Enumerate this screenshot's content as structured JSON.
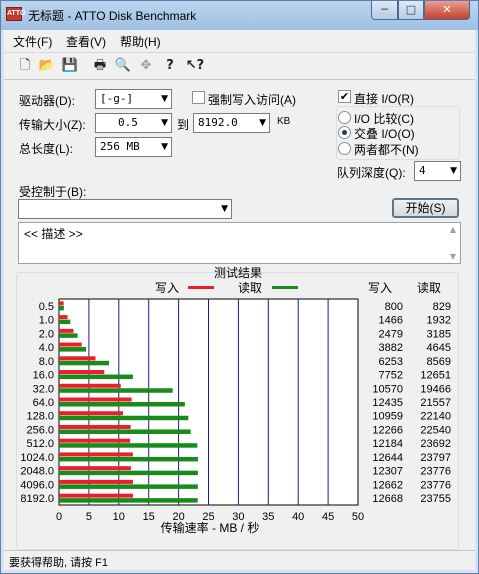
{
  "window": {
    "title": "无标题 - ATTO Disk Benchmark",
    "app_icon": "ATTO",
    "min_label": "─",
    "max_label": "□",
    "close_label": "✕"
  },
  "menu": [
    "文件(F)",
    "查看(V)",
    "帮助(H)"
  ],
  "toolbar": [
    {
      "icon": "new-file-icon",
      "glyph": "🗋"
    },
    {
      "icon": "open-folder-icon",
      "glyph": "📂"
    },
    {
      "icon": "save-icon",
      "glyph": "💾"
    },
    {
      "icon": "print-icon",
      "glyph": "🖶"
    },
    {
      "icon": "print-preview-icon",
      "glyph": "🔍"
    },
    {
      "icon": "move-icon",
      "glyph": "✥"
    },
    {
      "icon": "help-icon",
      "glyph": "?"
    },
    {
      "icon": "context-help-icon",
      "glyph": "↖?"
    }
  ],
  "settings": {
    "drive_label": "驱动器(D):",
    "drive_value": "[-g-]",
    "force_write_label": "强制写入访问(A)",
    "force_write_checked": false,
    "direct_io_label": "直接 I/O(R)",
    "direct_io_checked": true,
    "transfer_label": "传输大小(Z):",
    "transfer_from": "0.5",
    "transfer_to_label": "到",
    "transfer_to": "8192.0",
    "transfer_unit": "KB",
    "total_label": "总长度(L):",
    "total_value": "256 MB",
    "io_compare_label": "I/O 比较(C)",
    "io_overlap_label": "交叠 I/O(O)",
    "neither_label": "两者都不(N)",
    "selected_mode": "交叠 I/O(O)",
    "queue_label": "队列深度(Q):",
    "queue_value": "4",
    "controlled_label": "受控制于(B):",
    "controlled_value": "",
    "start_button": "开始(S)",
    "description": "<< 描述 >>"
  },
  "status": "要获得帮助, 请按 F1",
  "colors": {
    "write": "#e8202a",
    "read": "#1a8a1a",
    "grid": "#1a1a8a"
  },
  "chart_data": {
    "type": "bar",
    "title": "测试结果",
    "xlabel": "传输速率 - MB / 秒",
    "legend": [
      {
        "name": "写入",
        "color": "#e8202a"
      },
      {
        "name": "读取",
        "color": "#1a8a1a"
      }
    ],
    "table_headers": [
      "写入",
      "读取"
    ],
    "categories": [
      "0.5",
      "1.0",
      "2.0",
      "4.0",
      "8.0",
      "16.0",
      "32.0",
      "64.0",
      "128.0",
      "256.0",
      "512.0",
      "1024.0",
      "2048.0",
      "4096.0",
      "8192.0"
    ],
    "x_ticks": [
      "0",
      "5",
      "10",
      "15",
      "20",
      "25",
      "30",
      "35",
      "40",
      "45",
      "50"
    ],
    "xlim": [
      0,
      50
    ],
    "grid": true,
    "series": [
      {
        "name": "写入",
        "values": [
          800,
          1466,
          2479,
          3882,
          6253,
          7752,
          10570,
          12435,
          10959,
          12266,
          12184,
          12644,
          12307,
          12662,
          12668
        ]
      },
      {
        "name": "读取",
        "values": [
          829,
          1932,
          3185,
          4645,
          8569,
          12651,
          19466,
          21557,
          22140,
          22540,
          23692,
          23797,
          23776,
          23776,
          23755
        ]
      }
    ],
    "value_unit": "KB/s"
  }
}
